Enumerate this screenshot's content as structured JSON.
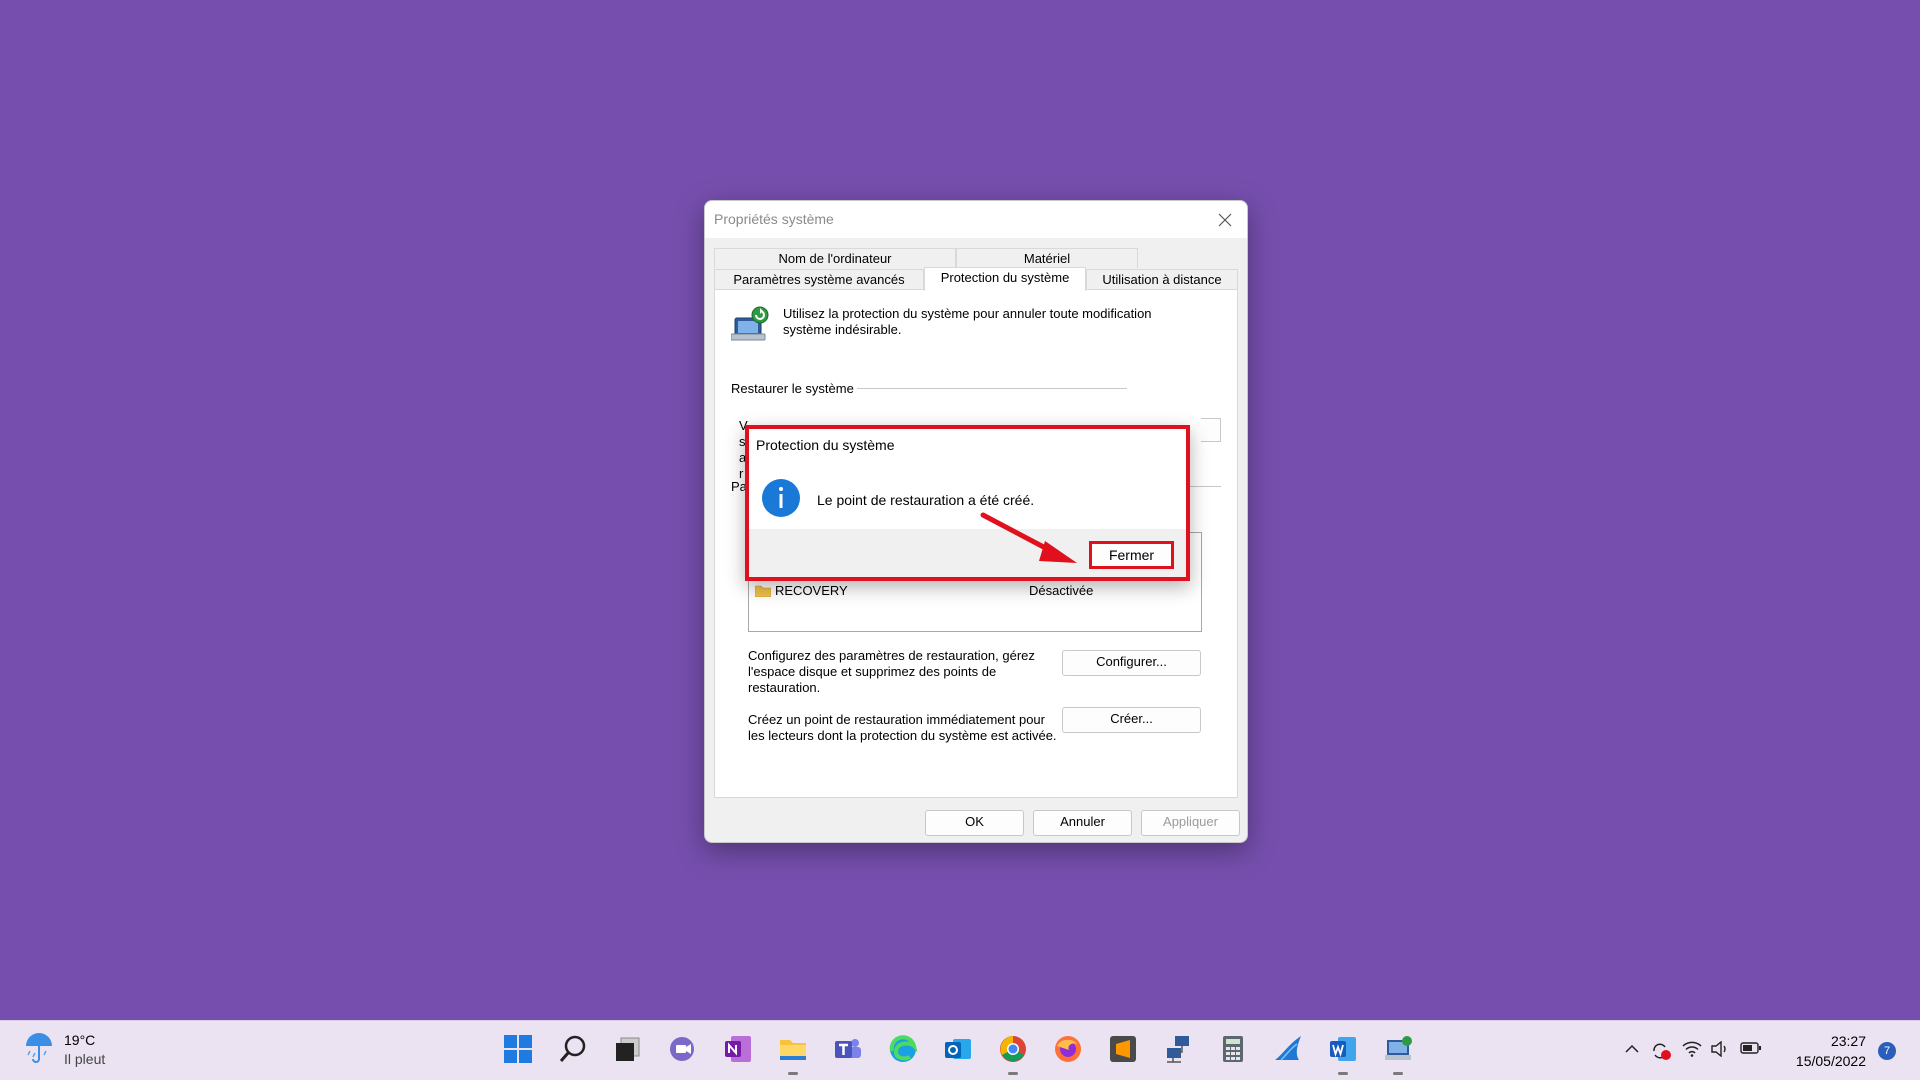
{
  "dialog": {
    "title": "Propriétés système",
    "tabs": {
      "row1": [
        "Nom de l'ordinateur",
        "Matériel"
      ],
      "row2": [
        "Paramètres système avancés",
        "Protection du système",
        "Utilisation à distance"
      ]
    },
    "description": "Utilisez la protection du système pour annuler toute modification système indésirable.",
    "restore_group_title": "Restaurer le système",
    "restore_partial": "V\ns\na\nr",
    "protection_group_partial": "Pa",
    "drive": {
      "name": "RECOVERY",
      "status": "Désactivée"
    },
    "configure_text": "Configurez des paramètres de restauration, gérez l'espace disque et supprimez des points de restauration.",
    "configure_button": "Configurer...",
    "create_text": "Créez un point de restauration immédiatement pour les lecteurs dont la protection du système est activée.",
    "create_button": "Créer...",
    "ok_button": "OK",
    "cancel_button": "Annuler",
    "apply_button": "Appliquer"
  },
  "modal": {
    "title": "Protection du système",
    "message": "Le point de restauration a été créé.",
    "close_button": "Fermer"
  },
  "taskbar": {
    "weather": {
      "temp": "19°C",
      "condition": "Il pleut"
    },
    "apps": [
      "windows-start",
      "search",
      "task-view",
      "teams-chat",
      "onenote",
      "file-explorer",
      "teams",
      "edge",
      "outlook",
      "chrome",
      "firefox",
      "sublime-text",
      "network",
      "calculator",
      "cloud-app",
      "word",
      "system-properties"
    ],
    "clock": {
      "time": "23:27",
      "date": "15/05/2022"
    },
    "notification_count": "7"
  },
  "colors": {
    "desktop": "#764fae",
    "highlight": "#e0101c",
    "info": "#1a78d6"
  }
}
